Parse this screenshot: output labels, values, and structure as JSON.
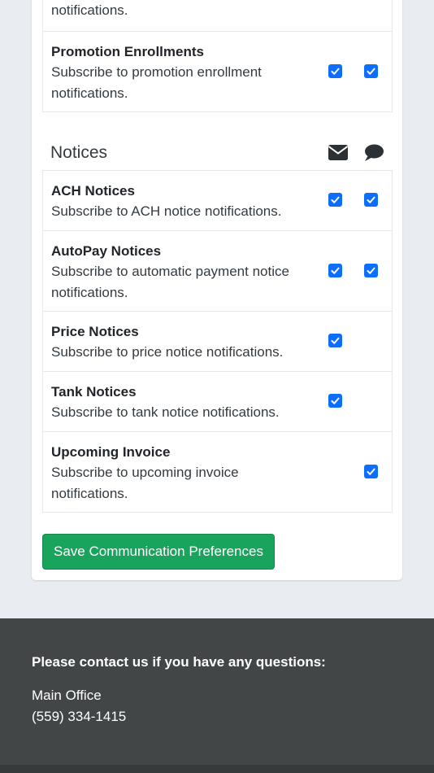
{
  "promotions": {
    "partial_row_desc": "notifications.",
    "rows": [
      {
        "title": "Promotion Enrollments",
        "description": "Subscribe to promotion enrollment notifications.",
        "email": true,
        "sms": true
      }
    ]
  },
  "notices": {
    "title": "Notices",
    "channel_icons": [
      "envelope-icon",
      "speech-bubble-icon"
    ],
    "rows": [
      {
        "title": "ACH Notices",
        "description": "Subscribe to ACH notice notifications.",
        "email": true,
        "sms": true
      },
      {
        "title": "AutoPay Notices",
        "description": "Subscribe to automatic payment notice notifications.",
        "email": true,
        "sms": true
      },
      {
        "title": "Price Notices",
        "description": "Subscribe to price notice notifications.",
        "email": true,
        "sms": false
      },
      {
        "title": "Tank Notices",
        "description": "Subscribe to tank notice notifications.",
        "email": true,
        "sms": false
      },
      {
        "title": "Upcoming Invoice",
        "description": "Subscribe to upcoming invoice notifications.",
        "email": false,
        "sms": true
      }
    ]
  },
  "actions": {
    "save_label": "Save Communication Preferences"
  },
  "footer": {
    "heading": "Please contact us if you have any questions:",
    "office_label": "Main Office",
    "phone": "(559) 334-1415"
  },
  "colors": {
    "checkbox": "#0d6efd",
    "save_button": "#1aa35c",
    "footer_bg": "#424647",
    "page_bg": "#e9ecf1"
  }
}
